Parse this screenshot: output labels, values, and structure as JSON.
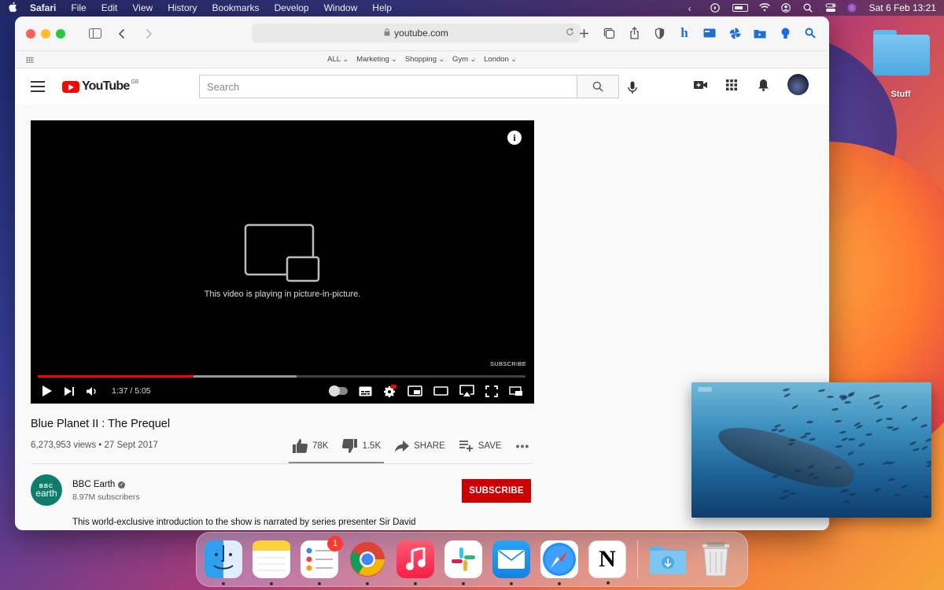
{
  "menubar": {
    "app": "Safari",
    "items": [
      "File",
      "Edit",
      "View",
      "History",
      "Bookmarks",
      "Develop",
      "Window",
      "Help"
    ],
    "clock": "Sat 6 Feb  13:21"
  },
  "desktop": {
    "folder_label": "Stuff"
  },
  "browser": {
    "url": "youtube.com",
    "favorites": [
      "ALL",
      "Marketing",
      "Shopping",
      "Gym",
      "London"
    ]
  },
  "youtube": {
    "logo_text": "YouTube",
    "region": "GB",
    "search_placeholder": "Search",
    "player": {
      "pip_message": "This video is playing in picture-in-picture.",
      "watermark": "SUBSCRIBE",
      "time": "1:37 / 5:05",
      "played_fraction": 0.32,
      "buffered_fraction": 0.53
    },
    "video": {
      "title": "Blue Planet II : The Prequel",
      "meta": "6,273,953 views • 27 Sept 2017",
      "likes": "78K",
      "dislikes": "1.5K",
      "share_label": "SHARE",
      "save_label": "SAVE"
    },
    "channel": {
      "logo_line1": "BBC",
      "logo_line2": "earth",
      "name": "BBC Earth",
      "subscribers": "8.97M subscribers",
      "subscribe_label": "SUBSCRIBE"
    },
    "description": "This world-exclusive introduction to the show is narrated by series presenter Sir David"
  },
  "dock": {
    "reminders_badge": "1"
  },
  "colors": {
    "youtube_red": "#ff0000",
    "subscribe_red": "#cc0000"
  }
}
